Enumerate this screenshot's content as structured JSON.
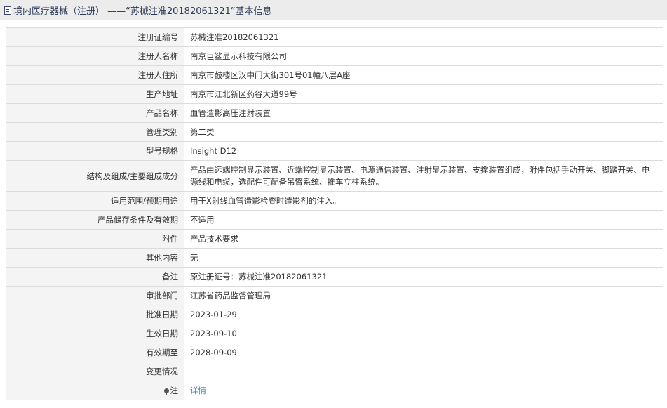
{
  "header": {
    "icon": "document-icon",
    "title": "境内医疗器械（注册） ——“苏械注准20182061321”基本信息"
  },
  "rows": [
    {
      "label": "注册证编号",
      "value": "苏械注准20182061321"
    },
    {
      "label": "注册人名称",
      "value": "南京巨鲨显示科技有限公司"
    },
    {
      "label": "注册人住所",
      "value": "南京市鼓楼区汉中门大街301号01幢八层A座"
    },
    {
      "label": "生产地址",
      "value": "南京市江北新区药谷大道99号"
    },
    {
      "label": "产品名称",
      "value": "血管造影高压注射装置"
    },
    {
      "label": "管理类别",
      "value": "第二类"
    },
    {
      "label": "型号规格",
      "value": "Insight D12"
    },
    {
      "label": "结构及组成/主要组成成分",
      "value": "产品由远端控制显示装置、近端控制显示装置、电源通信装置、注射显示装置、支撑装置组成，附件包括手动开关、脚踏开关、电源线和电缆，选配件可配备吊臂系统、推车立柱系统。"
    },
    {
      "label": "适用范围/预期用途",
      "value": "用于X射线血管造影检查时造影剂的注入。"
    },
    {
      "label": "产品储存条件及有效期",
      "value": "不适用"
    },
    {
      "label": "附件",
      "value": "产品技术要求"
    },
    {
      "label": "其他内容",
      "value": "无"
    },
    {
      "label": "备注",
      "value": "原注册证号：苏械注准20182061321"
    },
    {
      "label": "审批部门",
      "value": "江苏省药品监督管理局"
    },
    {
      "label": "批准日期",
      "value": "2023-01-29"
    },
    {
      "label": "生效日期",
      "value": "2023-09-10"
    },
    {
      "label": "有效期至",
      "value": "2028-09-09"
    },
    {
      "label": "变更情况",
      "value": ""
    }
  ],
  "note_row": {
    "icon": "pin-icon",
    "label": "注",
    "link_text": "详情"
  }
}
